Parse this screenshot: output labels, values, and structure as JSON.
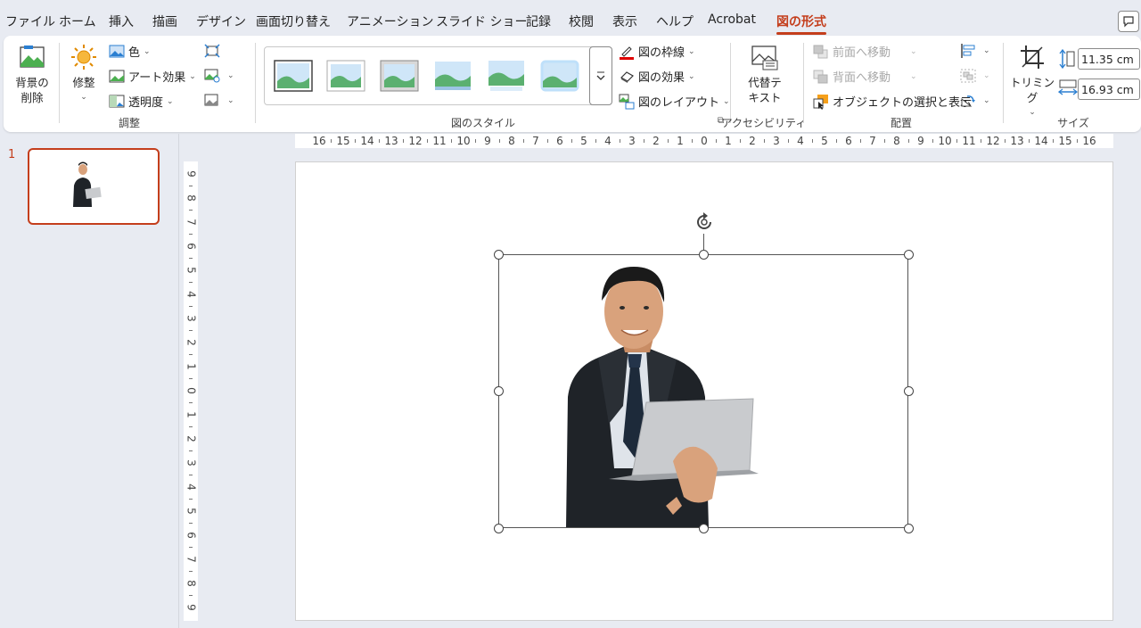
{
  "tabs": [
    {
      "label": "ファイル"
    },
    {
      "label": "ホーム"
    },
    {
      "label": "挿入"
    },
    {
      "label": "描画"
    },
    {
      "label": "デザイン"
    },
    {
      "label": "画面切り替え"
    },
    {
      "label": "アニメーション"
    },
    {
      "label": "スライド ショー"
    },
    {
      "label": "記録"
    },
    {
      "label": "校閲"
    },
    {
      "label": "表示"
    },
    {
      "label": "ヘルプ"
    },
    {
      "label": "Acrobat"
    },
    {
      "label": "図の形式"
    }
  ],
  "active_tab": "図の形式",
  "ribbon": {
    "adjust": {
      "remove_bg_line1": "背景の",
      "remove_bg_line2": "削除",
      "corrections": "修整",
      "color": "色",
      "artistic": "アート効果",
      "transparency": "透明度",
      "label": "調整"
    },
    "styles": {
      "border": "図の枠線",
      "effects": "図の効果",
      "layout": "図のレイアウト",
      "label": "図のスタイル"
    },
    "accessibility": {
      "alt_text_line1": "代替テ",
      "alt_text_line2": "キスト",
      "label": "アクセシビリティ"
    },
    "arrange": {
      "bring_forward": "前面へ移動",
      "send_backward": "背面へ移動",
      "selection_pane": "オブジェクトの選択と表示",
      "label": "配置"
    },
    "size": {
      "crop": "トリミング",
      "height": "11.35 cm",
      "width": "16.93 cm",
      "label": "サイズ"
    }
  },
  "slides": [
    {
      "number": "1"
    }
  ],
  "ruler_h_labels": [
    "16",
    "15",
    "14",
    "13",
    "12",
    "11",
    "10",
    "9",
    "8",
    "7",
    "6",
    "5",
    "4",
    "3",
    "2",
    "1",
    "0",
    "1",
    "2",
    "3",
    "4",
    "5",
    "6",
    "7",
    "8",
    "9",
    "10",
    "11",
    "12",
    "13",
    "14",
    "15",
    "16"
  ],
  "ruler_v_labels": [
    "9",
    "8",
    "7",
    "6",
    "5",
    "4",
    "3",
    "2",
    "1",
    "0",
    "1",
    "2",
    "3",
    "4",
    "5",
    "6",
    "7",
    "8",
    "9"
  ],
  "colors": {
    "accent": "#c43e1c",
    "suit": "#1f2328",
    "tie": "#1d2a3a",
    "laptop": "#c9cbce"
  }
}
